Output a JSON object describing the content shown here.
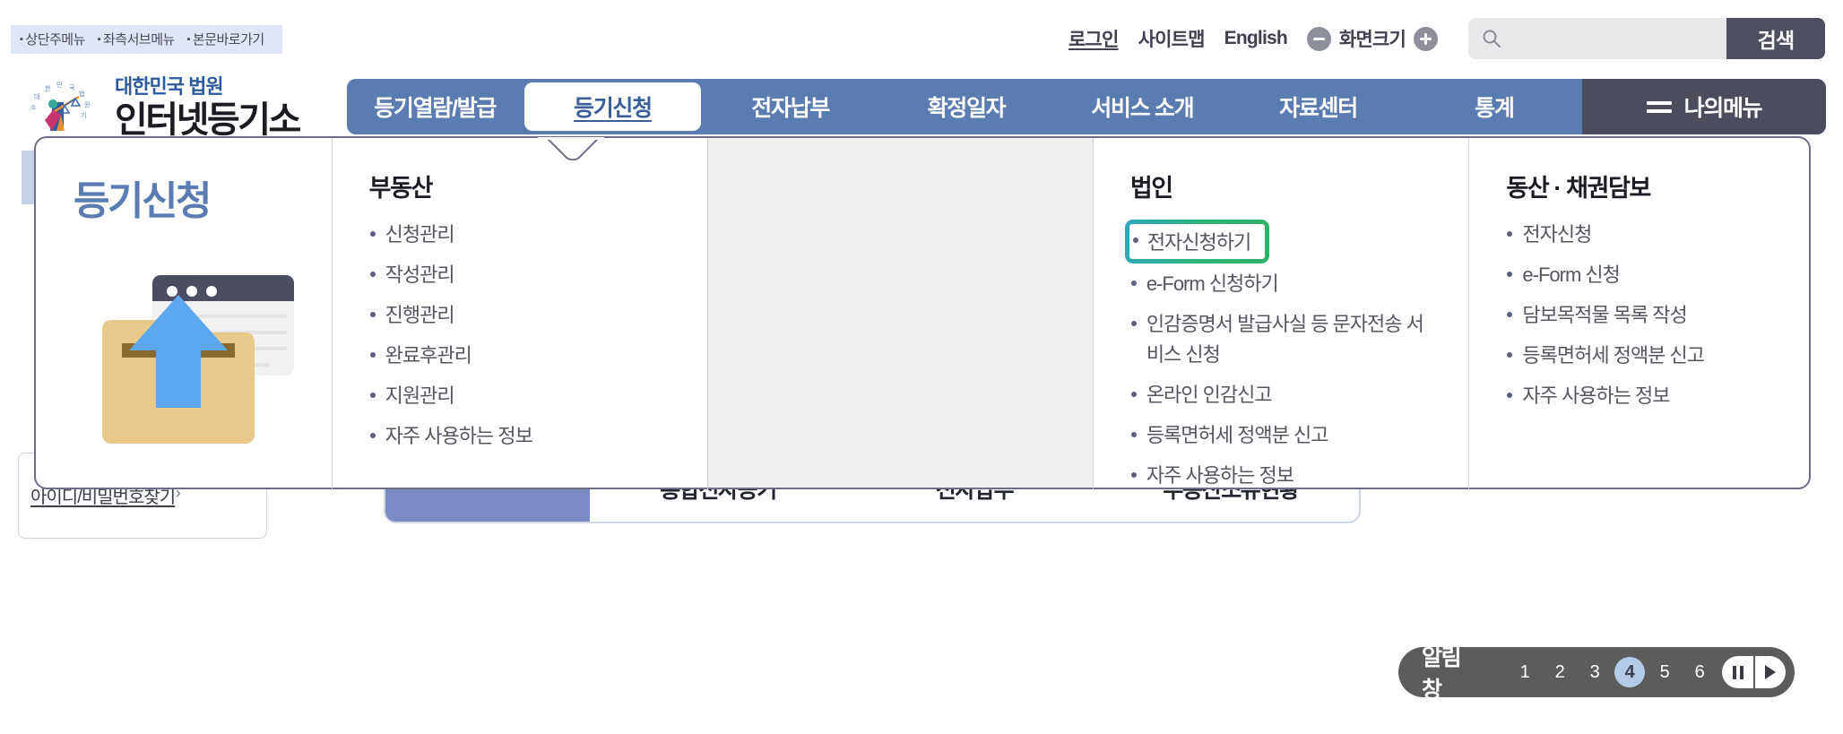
{
  "skip_links": [
    "상단주메뉴",
    "좌측서브메뉴",
    "본문바로가기"
  ],
  "utility": {
    "login": "로그인",
    "sitemap": "사이트맵",
    "english": "English",
    "screen_size_label": "화면크기",
    "minus_icon": "minus-circle-icon",
    "plus_icon": "plus-circle-icon",
    "search_placeholder": "",
    "search_value": "",
    "search_button": "검색",
    "search_icon": "search-icon"
  },
  "logo": {
    "top_line": "대한민국 법원",
    "main_line": "인터넷등기소",
    "mark": "court-scales-logo-icon"
  },
  "nav": {
    "items": [
      {
        "label": "등기열람/발급",
        "active": false
      },
      {
        "label": "등기신청",
        "active": true
      },
      {
        "label": "전자납부",
        "active": false
      },
      {
        "label": "확정일자",
        "active": false
      },
      {
        "label": "서비스 소개",
        "active": false
      },
      {
        "label": "자료센터",
        "active": false
      },
      {
        "label": "통계",
        "active": false
      }
    ],
    "mymenu": {
      "label": "나의메뉴",
      "icon": "hamburger-icon"
    }
  },
  "mega": {
    "title": "등기신청",
    "illustration": "upload-to-folder-illustration",
    "columns": [
      {
        "heading": "부동산",
        "items": [
          {
            "label": "신청관리",
            "highlighted": false
          },
          {
            "label": "작성관리",
            "highlighted": false
          },
          {
            "label": "진행관리",
            "highlighted": false
          },
          {
            "label": "완료후관리",
            "highlighted": false
          },
          {
            "label": "지원관리",
            "highlighted": false
          },
          {
            "label": "자주 사용하는 정보",
            "highlighted": false
          }
        ]
      },
      {
        "heading": "법인",
        "items": [
          {
            "label": "전자신청하기",
            "highlighted": true
          },
          {
            "label": "e-Form 신청하기",
            "highlighted": false
          },
          {
            "label": "인감증명서 발급사실 등 문자전송 서비스 신청",
            "highlighted": false
          },
          {
            "label": "온라인 인감신고",
            "highlighted": false
          },
          {
            "label": "등록면허세 정액분 신고",
            "highlighted": false
          },
          {
            "label": "자주 사용하는 정보",
            "highlighted": false
          }
        ]
      },
      {
        "heading": "동산 · 채권담보",
        "items": [
          {
            "label": "전자신청",
            "highlighted": false
          },
          {
            "label": "e-Form 신청",
            "highlighted": false
          },
          {
            "label": "담보목적물 목록 작성",
            "highlighted": false
          },
          {
            "label": "등록면허세 정액분 신고",
            "highlighted": false
          },
          {
            "label": "자주 사용하는 정보",
            "highlighted": false
          }
        ]
      }
    ]
  },
  "background": {
    "find_id_pw": "아이디/비밀번호찾기",
    "find_id_arrow": "›",
    "quick_items": [
      "통합전자등기",
      "전자납부",
      "부동산소유현황"
    ]
  },
  "notice": {
    "label": "알림창",
    "pages": [
      "1",
      "2",
      "3",
      "4",
      "5",
      "6"
    ],
    "active_page": "4",
    "pause_icon": "pause-icon",
    "next_icon": "next-icon"
  },
  "colors": {
    "nav_blue": "#5b7cb0",
    "mymenu_dark": "#4b4d5c",
    "highlight_gradient_start": "#2fa7bd",
    "highlight_gradient_end": "#2eb167",
    "title_blue": "#5b7cb0",
    "notice_gray": "#5c5c5c",
    "active_page_blue": "#b4cbe8"
  }
}
